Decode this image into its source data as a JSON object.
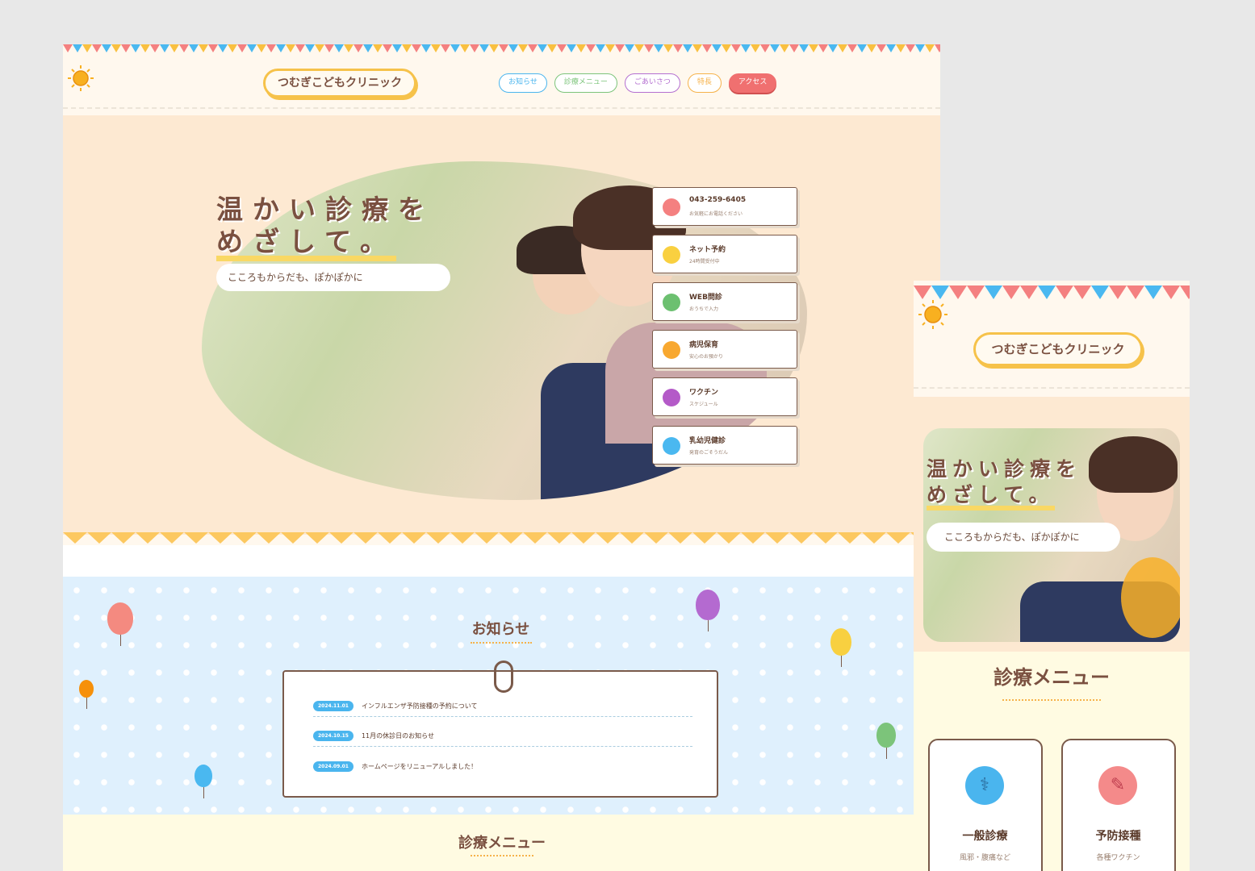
{
  "desktop": {
    "logo": "つむぎこどもクリニック",
    "nav": [
      {
        "label": "お知らせ",
        "color": "#4ab5ee"
      },
      {
        "label": "診療メニュー",
        "color": "#7cc47a"
      },
      {
        "label": "ごあいさつ",
        "color": "#b46fd0"
      },
      {
        "label": "特長",
        "color": "#f6b24a"
      },
      {
        "label": "アクセス",
        "color": "#f07070"
      }
    ],
    "hero": {
      "line1": "温かい診療を",
      "line2": "めざして。",
      "sub": "こころもからだも、ぽかぽかに"
    },
    "cards": [
      {
        "title": "043-259-6405",
        "sub": "お気軽にお電話ください",
        "color": "#f48080"
      },
      {
        "title": "ネット予約",
        "sub": "24時間受付中",
        "color": "#f9d040"
      },
      {
        "title": "WEB問診",
        "sub": "おうちで入力",
        "color": "#6cc070"
      },
      {
        "title": "病児保育",
        "sub": "安心のお預かり",
        "color": "#f8a830"
      },
      {
        "title": "ワクチン",
        "sub": "スケジュール",
        "color": "#b45ac8"
      },
      {
        "title": "乳幼児健診",
        "sub": "発育のごそうだん",
        "color": "#4ab8f0"
      }
    ],
    "news": {
      "title": "お知らせ",
      "items": [
        {
          "date": "2024.11.01",
          "text": "インフルエンザ予防接種の予約について"
        },
        {
          "date": "2024.10.15",
          "text": "11月の休診日のお知らせ"
        },
        {
          "date": "2024.09.01",
          "text": "ホームページをリニューアルしました！"
        }
      ]
    },
    "menu_title": "診療メニュー"
  },
  "mobile": {
    "logo": "つむぎこどもクリニック",
    "hero": {
      "line1": "温かい診療を",
      "line2": "めざして。",
      "sub": "こころもからだも、ぽかぽかに"
    },
    "menu_title": "診療メニュー",
    "menu_cards": [
      {
        "title": "一般診療",
        "sub": "風邪・腹痛など",
        "color": "#4ab5ee"
      },
      {
        "title": "予防接種",
        "sub": "各種ワクチン",
        "color": "#f48a8a"
      }
    ]
  }
}
